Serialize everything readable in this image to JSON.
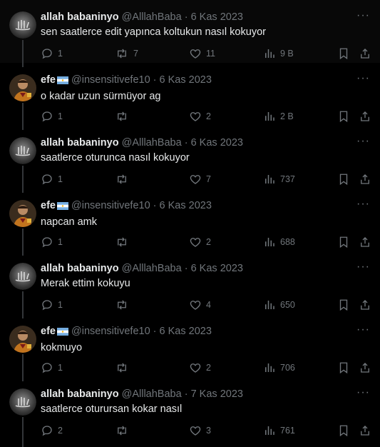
{
  "colors": {
    "background": "#000000",
    "text": "#e7e9ea",
    "muted": "#71767b",
    "thread_line": "#333639"
  },
  "users": {
    "allah": {
      "name": "allah babaninyo",
      "handle": "@AlllahBaba",
      "avatar_icon": "arabic-calligraphy-avatar"
    },
    "efe": {
      "name": "efe",
      "handle": "@insensitivefe10",
      "avatar_icon": "football-player-avatar",
      "flag_icon": "argentina-flag-icon"
    }
  },
  "tweets": [
    {
      "user": "allah",
      "name": "allah babaninyo",
      "handle": "@AlllahBaba",
      "dot": "·",
      "date": "6 Kas 2023",
      "text": "sen saatlerce edit yapınca koltukun nasıl kokuyor",
      "replies": "1",
      "retweets": "7",
      "likes": "11",
      "views": "9 B"
    },
    {
      "user": "efe",
      "name": "efe",
      "handle": "@insensitivefe10",
      "dot": "·",
      "date": "6 Kas 2023",
      "text": "o kadar uzun sürmüyor ag",
      "replies": "1",
      "retweets": "",
      "likes": "2",
      "views": "2 B"
    },
    {
      "user": "allah",
      "name": "allah babaninyo",
      "handle": "@AlllahBaba",
      "dot": "·",
      "date": "6 Kas 2023",
      "text": "saatlerce oturunca nasıl kokuyor",
      "replies": "1",
      "retweets": "",
      "likes": "7",
      "views": "737"
    },
    {
      "user": "efe",
      "name": "efe",
      "handle": "@insensitivefe10",
      "dot": "·",
      "date": "6 Kas 2023",
      "text": "napcan amk",
      "replies": "1",
      "retweets": "",
      "likes": "2",
      "views": "688"
    },
    {
      "user": "allah",
      "name": "allah babaninyo",
      "handle": "@AlllahBaba",
      "dot": "·",
      "date": "6 Kas 2023",
      "text": "Merak ettim kokuyu",
      "replies": "1",
      "retweets": "",
      "likes": "4",
      "views": "650"
    },
    {
      "user": "efe",
      "name": "efe",
      "handle": "@insensitivefe10",
      "dot": "·",
      "date": "6 Kas 2023",
      "text": "kokmuyo",
      "replies": "1",
      "retweets": "",
      "likes": "2",
      "views": "706"
    },
    {
      "user": "allah",
      "name": "allah babaninyo",
      "handle": "@AlllahBaba",
      "dot": "·",
      "date": "7 Kas 2023",
      "text": "saatlerce oturursan kokar nasıl",
      "replies": "2",
      "retweets": "",
      "likes": "3",
      "views": "761"
    }
  ],
  "icons": {
    "more": "more-options-icon",
    "reply": "reply-icon",
    "retweet": "retweet-icon",
    "like": "heart-icon",
    "views": "views-icon",
    "bookmark": "bookmark-icon",
    "share": "share-icon"
  },
  "more_glyph": "···"
}
